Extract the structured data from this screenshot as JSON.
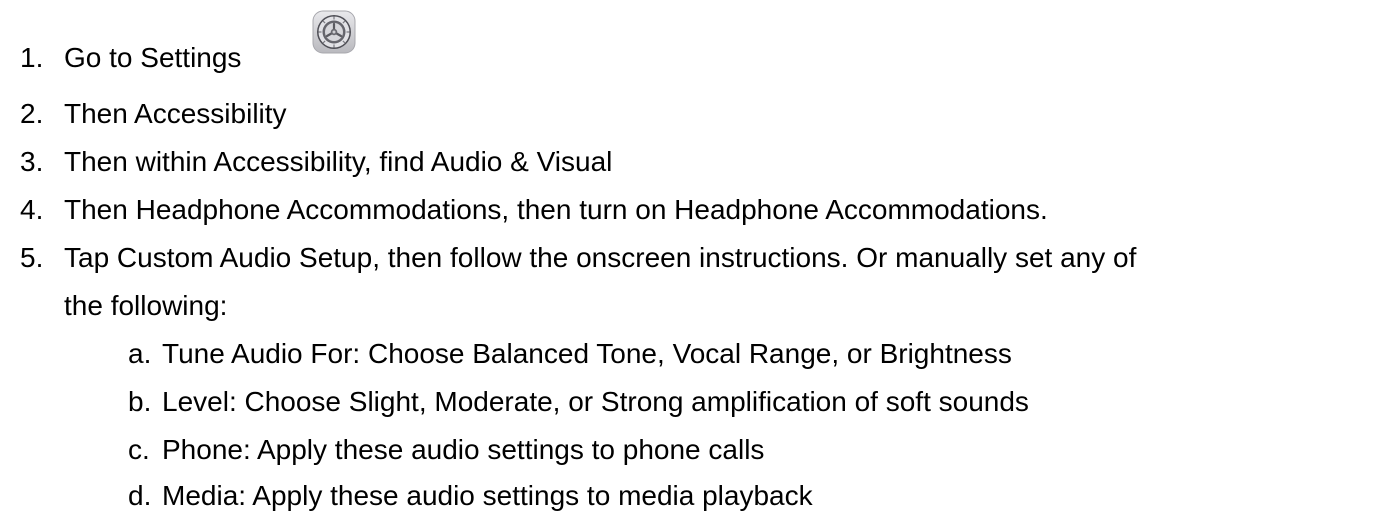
{
  "steps": [
    {
      "number": "1.",
      "text": "Go to Settings",
      "icon": "settings-gear-icon"
    },
    {
      "number": "2.",
      "text": "Then Accessibility"
    },
    {
      "number": "3.",
      "text": "Then within Accessibility, find Audio & Visual"
    },
    {
      "number": "4.",
      "text": "Then Headphone Accommodations, then turn on Headphone Accommodations."
    },
    {
      "number": "5.",
      "text_line1": "Tap Custom Audio Setup, then follow the onscreen instructions. Or manually set any of",
      "text_line2": "the following:",
      "substeps": [
        {
          "letter": "a.",
          "text": "Tune Audio For: Choose Balanced Tone, Vocal Range, or Brightness"
        },
        {
          "letter": "b.",
          "text": "Level: Choose Slight, Moderate, or Strong amplification of soft sounds"
        },
        {
          "letter": "c.",
          "text": "Phone: Apply these audio settings to phone calls"
        },
        {
          "letter": "d.",
          "text": "Media: Apply these audio settings to media playback"
        }
      ]
    }
  ]
}
